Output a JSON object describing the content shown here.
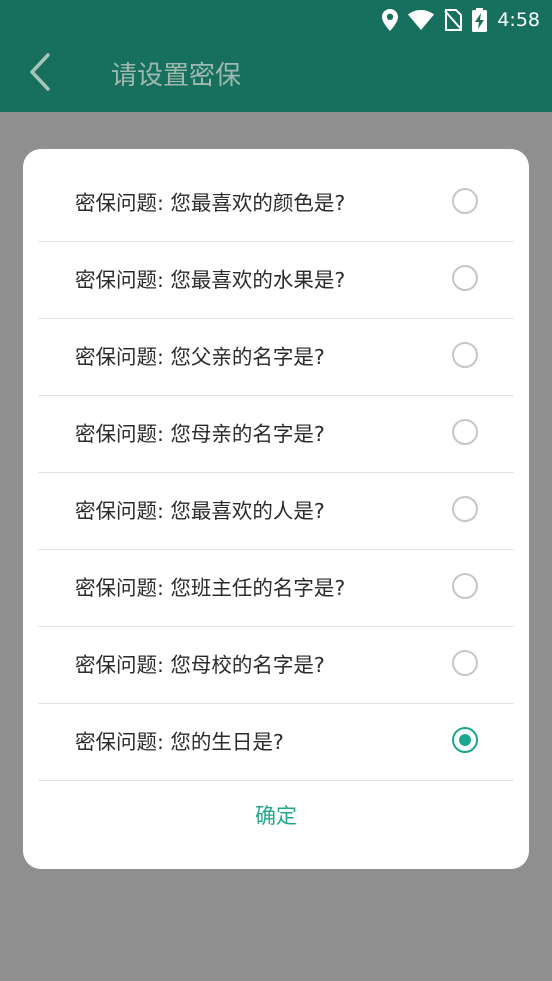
{
  "status_bar": {
    "time": "4:58"
  },
  "app_bar": {
    "title": "请设置密保"
  },
  "dialog": {
    "options": [
      {
        "label": "密保问题: 您最喜欢的颜色是?",
        "selected": false
      },
      {
        "label": "密保问题: 您最喜欢的水果是?",
        "selected": false
      },
      {
        "label": "密保问题: 您父亲的名字是?",
        "selected": false
      },
      {
        "label": "密保问题: 您母亲的名字是?",
        "selected": false
      },
      {
        "label": "密保问题: 您最喜欢的人是?",
        "selected": false
      },
      {
        "label": "密保问题: 您班主任的名字是?",
        "selected": false
      },
      {
        "label": "密保问题: 您母校的名字是?",
        "selected": false
      },
      {
        "label": "密保问题: 您的生日是?",
        "selected": true
      }
    ],
    "confirm_label": "确定"
  },
  "colors": {
    "app_bar": "#16705d",
    "accent": "#19a88c",
    "scrim": "#8f8f8f"
  }
}
